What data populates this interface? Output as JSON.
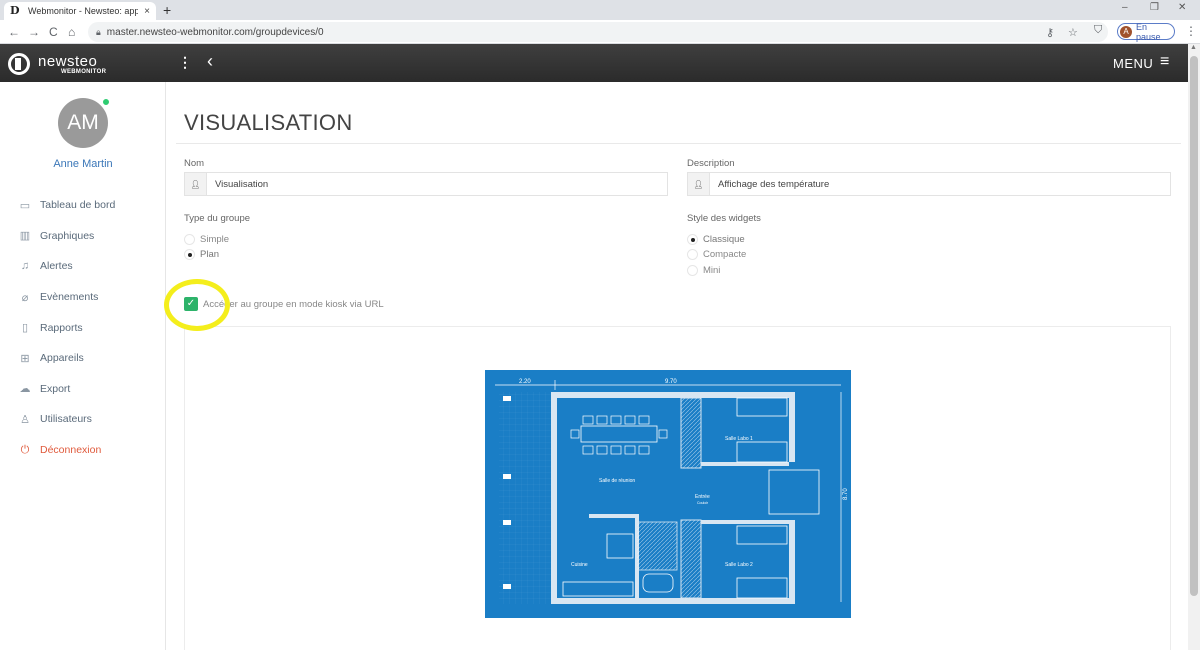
{
  "browser": {
    "tab_title": "Webmonitor - Newsteo: applicati",
    "tab_close": "×",
    "new_tab": "+",
    "window_controls": [
      "–",
      "❐",
      "✕"
    ],
    "nav": {
      "back": "←",
      "forward": "→",
      "reload": "C",
      "home": "⌂"
    },
    "url": "master.newsteo-webmonitor.com/groupdevices/0",
    "profile_initial": "A",
    "profile_status": "En pause",
    "icons": [
      "key-icon",
      "star-icon",
      "shield-extension-icon",
      "profile-avatar-icon",
      "more-vert-icon"
    ]
  },
  "header": {
    "logo_name": "newsteo",
    "logo_sub": "WEBMONITOR",
    "menu_label": "MENU",
    "menu_icon": "≡",
    "dots_icon": "⋮",
    "back_icon": "‹"
  },
  "sidebar": {
    "avatar_initials": "AM",
    "user_name": "Anne Martin",
    "items": [
      {
        "label": "Tableau de bord",
        "icon": "▭"
      },
      {
        "label": "Graphiques",
        "icon": "▥"
      },
      {
        "label": "Alertes",
        "icon": "♫"
      },
      {
        "label": "Evènements",
        "icon": "⌀"
      },
      {
        "label": "Rapports",
        "icon": "▯"
      },
      {
        "label": "Appareils",
        "icon": "⊞"
      },
      {
        "label": "Export",
        "icon": "☁"
      },
      {
        "label": "Utilisateurs",
        "icon": "♙"
      },
      {
        "label": "Déconnexion",
        "icon": "⏻"
      }
    ]
  },
  "main": {
    "title": "VISUALISATION",
    "name_label": "Nom",
    "name_value": "Visualisation",
    "description_label": "Description",
    "description_value": "Affichage des température",
    "group_type_label": "Type du groupe",
    "group_type_options": [
      "Simple",
      "Plan"
    ],
    "group_type_selected": "Plan",
    "widget_style_label": "Style des widgets",
    "widget_style_options": [
      "Classique",
      "Compacte",
      "Mini"
    ],
    "widget_style_selected": "Classique",
    "kiosk_label": "Accéder au groupe en mode kiosk via URL",
    "kiosk_checked": true
  },
  "plan": {
    "dim_top_left": "2.20",
    "dim_top_right": "9.70",
    "dim_right": "8.70",
    "rooms": [
      "Salle Labo 1",
      "Salle de réunion",
      "Entrée",
      "Couloir",
      "Cuisine",
      "Salle Labo 2"
    ]
  },
  "colors": {
    "header_bg": "#333333",
    "accent_link": "#3b77b8",
    "logout": "#e05a3c",
    "checkbox": "#2db36a",
    "blueprint": "#1a7ec6",
    "highlight": "#f4ee1c"
  }
}
